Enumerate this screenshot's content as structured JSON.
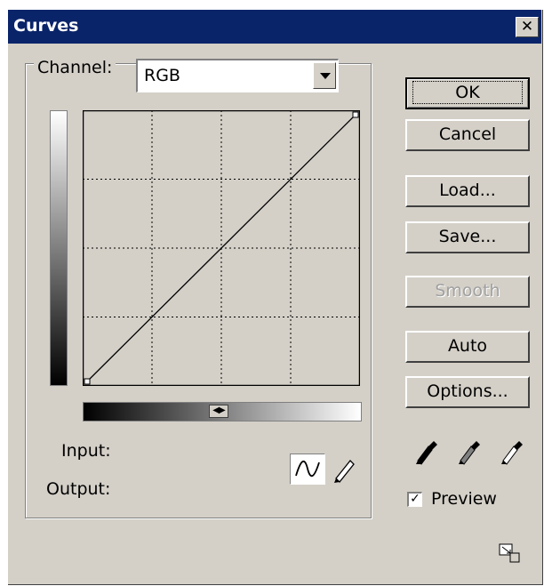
{
  "window": {
    "title": "Curves",
    "close_glyph": "✕"
  },
  "channel": {
    "label": "Channel:",
    "value": "RGB"
  },
  "graph": {
    "curve": "linear",
    "grid_divisions": 4
  },
  "hgrad": {
    "toggle_glyph": "◀▶"
  },
  "fields": {
    "input_label": "Input:",
    "output_label": "Output:"
  },
  "buttons": {
    "ok": "OK",
    "cancel": "Cancel",
    "load": "Load...",
    "save": "Save...",
    "smooth": "Smooth",
    "auto": "Auto",
    "options": "Options..."
  },
  "tools": {
    "curve_icon": "curve-tool-icon",
    "pencil_icon": "pencil-icon",
    "eyedroppers": [
      "black-eyedropper-icon",
      "gray-eyedropper-icon",
      "white-eyedropper-icon"
    ]
  },
  "preview": {
    "label": "Preview",
    "checked": true,
    "check_glyph": "✓"
  },
  "colors": {
    "titlebar": "#0a246a",
    "face": "#d4d0c8"
  }
}
